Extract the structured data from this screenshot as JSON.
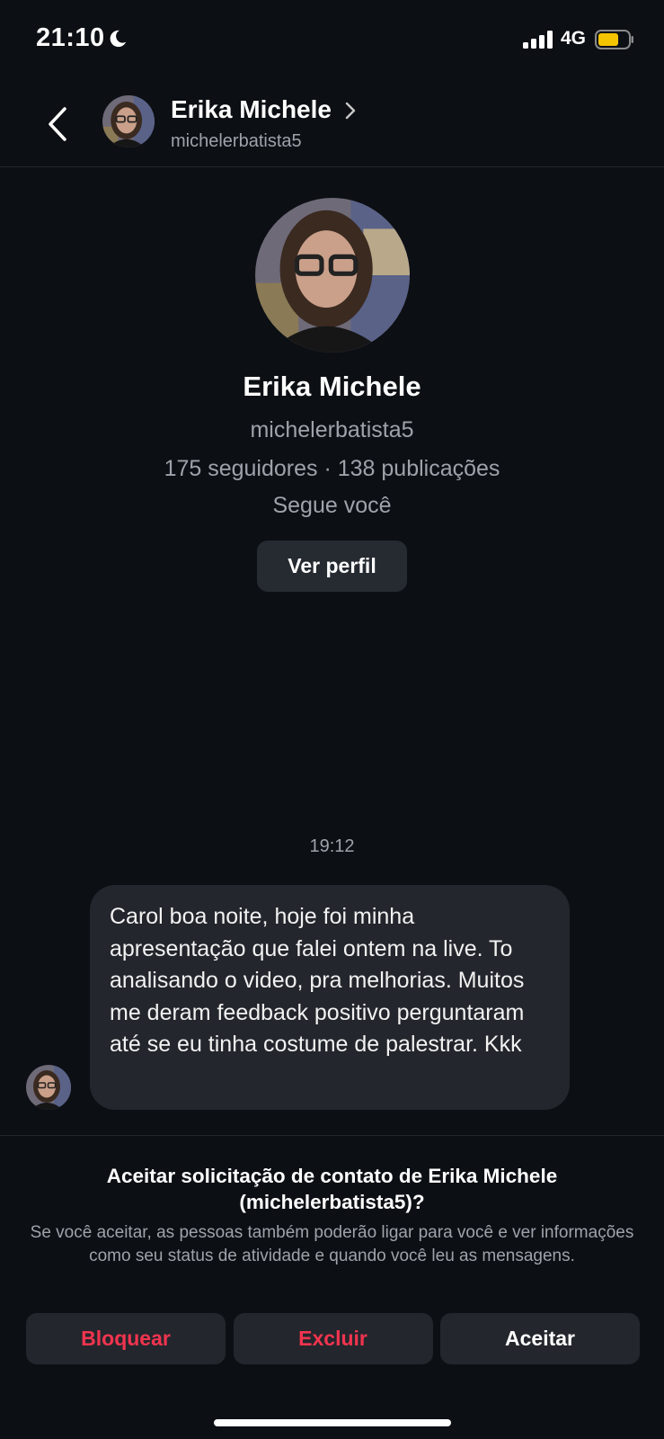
{
  "status_bar": {
    "time": "21:10",
    "network": "4G",
    "icons": [
      "moon-icon",
      "signal-icon",
      "battery-icon"
    ],
    "battery_color": "#f5c400"
  },
  "header": {
    "name": "Erika Michele",
    "username": "michelerbatista5",
    "icons": [
      "back-chevron-icon",
      "chevron-right-icon"
    ]
  },
  "profile": {
    "name": "Erika Michele",
    "username": "michelerbatista5",
    "stats": "175 seguidores · 138 publicações",
    "follows_you": "Segue você",
    "view_profile_label": "Ver perfil"
  },
  "conversation": {
    "timestamp": "19:12",
    "message": "Carol boa noite, hoje foi minha apresentação que falei ontem na live. To analisando o video, pra melhorias. Muitos me deram feedback positivo perguntaram até se eu tinha costume de palestrar. Kkk"
  },
  "request": {
    "title": "Aceitar solicitação de contato de Erika Michele (michelerbatista5)?",
    "description": "Se você aceitar, as pessoas também poderão ligar para você e ver informações como seu status de atividade e quando você leu as mensagens.",
    "block_label": "Bloquear",
    "delete_label": "Excluir",
    "accept_label": "Aceitar"
  },
  "colors": {
    "background": "#0c0f14",
    "surface": "#23262c",
    "danger": "#f2344f",
    "secondary_text": "#9ea3ab"
  }
}
